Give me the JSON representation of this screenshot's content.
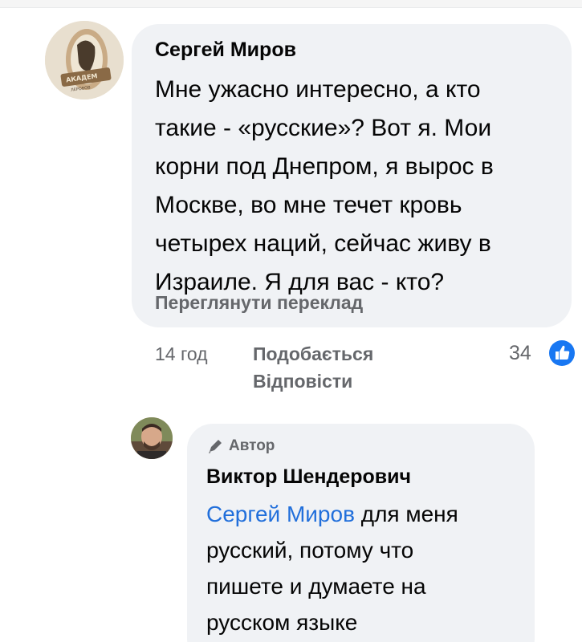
{
  "comment": {
    "author": "Сергей Миров",
    "text_lines": [
      "Мне ужасно интересно, а кто",
      "такие - «русские»? Вот я. Мои",
      "корни под Днепром, я вырос в",
      "Москве, во мне течет кровь",
      "четырех наций, сейчас живу в",
      "Израиле. Я для вас - кто?"
    ],
    "translate_label": "Переглянути переклад",
    "time": "14 год",
    "like_label": "Подобається",
    "reply_label": "Відповісти",
    "reaction_count": "34",
    "avatar_text": [
      "АКАДЕМ",
      "ЛЕРОВОВ"
    ]
  },
  "reply": {
    "author_badge": "Автор",
    "author": "Виктор Шендерович",
    "mention": "Сергей Миров",
    "text_first_line_rest": " для меня",
    "text_lines": [
      "русский, потому что",
      "пишете и думаете на",
      "русском языке"
    ]
  },
  "colors": {
    "bubble": "#f0f2f5",
    "meta": "#65676b",
    "mention": "#216fdb",
    "like_blue": "#1877f2",
    "text": "#050505"
  },
  "icons": [
    "like-reaction-icon",
    "pen-icon"
  ]
}
